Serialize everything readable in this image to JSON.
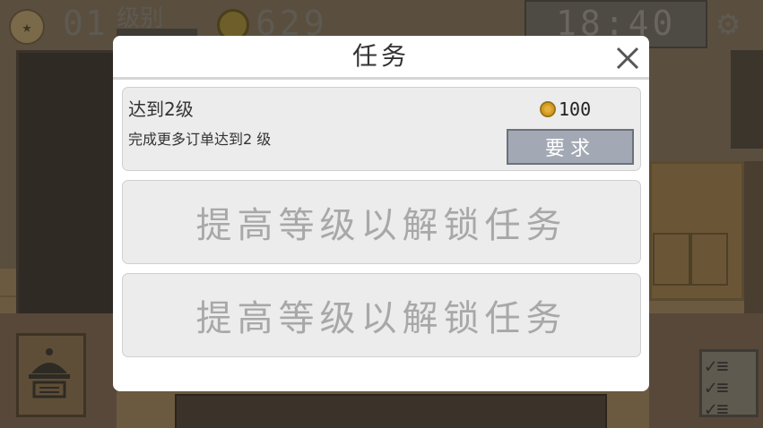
{
  "hud": {
    "level_number": "01",
    "level_label": "级别",
    "coins": "629",
    "time": "18:40",
    "icons": [
      "star-badge-icon",
      "coin-icon",
      "gear-icon",
      "service-bell-icon",
      "checklist-icon"
    ]
  },
  "dialog": {
    "title": "任务",
    "close_icon": "close-icon",
    "quest": {
      "title": "达到2级",
      "description": "完成更多订单达到2 级",
      "reward_amount": "100",
      "reward_icon": "coin-icon",
      "button_label": "要求"
    },
    "locked_slots": [
      {
        "label": "提高等级以解锁任务"
      },
      {
        "label": "提高等级以解锁任务"
      }
    ]
  },
  "colors": {
    "overlay_background": "#4a4236",
    "dialog_background": "#ffffff",
    "card_background": "#ececec",
    "button_background": "#a3a9b4",
    "locked_text": "#a8a8a8",
    "coin": "#e3b13a"
  }
}
